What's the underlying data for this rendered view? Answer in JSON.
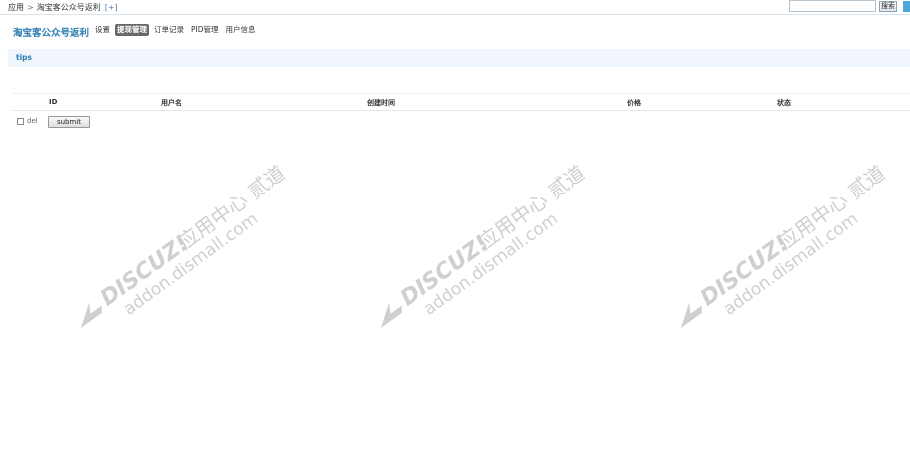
{
  "breadcrumb": {
    "root": "应用",
    "separator": ">",
    "current": "淘宝客公众号返利",
    "add": "[+]"
  },
  "search": {
    "value": "",
    "button_label": "搜索"
  },
  "app": {
    "title": "淘宝客公众号返利"
  },
  "nav": [
    {
      "label": "设置",
      "active": false
    },
    {
      "label": "提现管理",
      "active": true
    },
    {
      "label": "订单记录",
      "active": false
    },
    {
      "label": "PID管理",
      "active": false
    },
    {
      "label": "用户信息",
      "active": false
    }
  ],
  "tips": {
    "label": "tips"
  },
  "table": {
    "columns": [
      "ID",
      "用户名",
      "创建时间",
      "价格",
      "状态"
    ],
    "rows": []
  },
  "actions": {
    "del_label": "del",
    "submit_label": "submit"
  },
  "watermark": {
    "brand": "DISCUZ!",
    "line1": "应用中心",
    "line2": "贰道",
    "url": "addon.dismall.com"
  },
  "colors": {
    "accent": "#2b7cb1",
    "active_tab": "#686868",
    "tips_bg": "#f0f6fb"
  }
}
